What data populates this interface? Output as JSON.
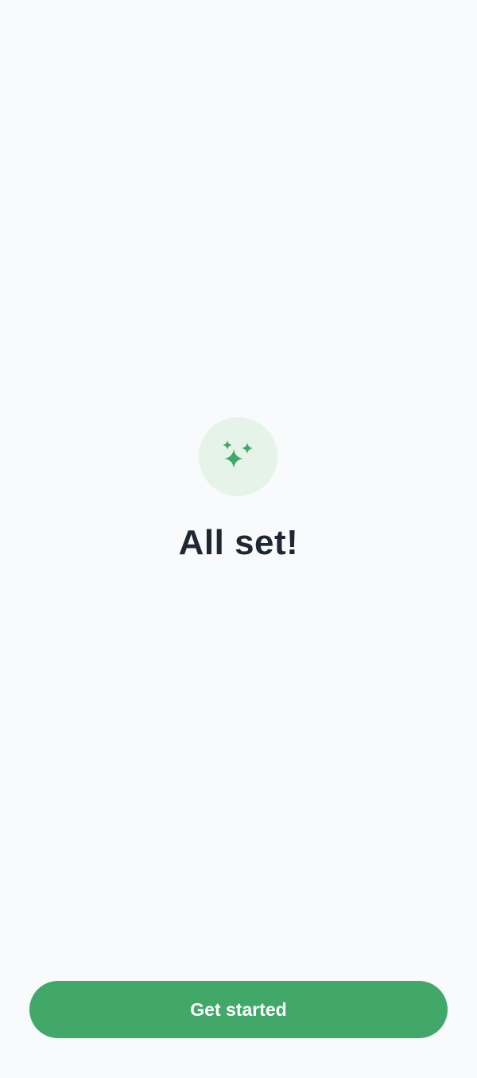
{
  "completion": {
    "icon": "sparkles-icon",
    "title": "All set!"
  },
  "actions": {
    "get_started_label": "Get started"
  },
  "colors": {
    "background": "#f8fafb",
    "accent": "#41a86a",
    "icon_background": "#e5f3e8",
    "title_text": "#1f2733",
    "button_text": "#ffffff"
  }
}
